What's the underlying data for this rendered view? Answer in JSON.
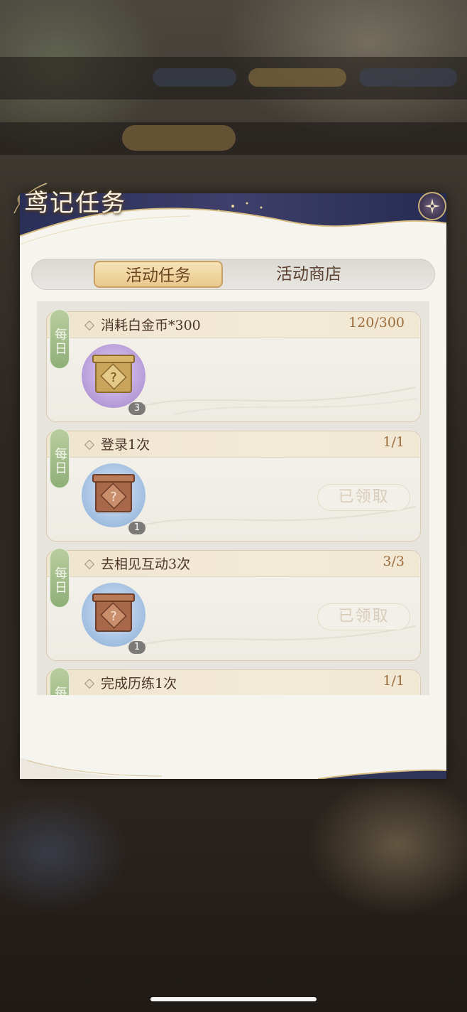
{
  "panel": {
    "title": "鸢记任务",
    "close_label": "",
    "tabs": [
      {
        "label": "活动任务",
        "active": true
      },
      {
        "label": "活动商店",
        "active": false
      }
    ]
  },
  "tasks": [
    {
      "tag": "每日",
      "name": "消耗白金币*300",
      "progress": "120/300",
      "reward_qty": "3",
      "reward_bg": "purple",
      "claimed": false,
      "claimed_label": ""
    },
    {
      "tag": "每日",
      "name": "登录1次",
      "progress": "1/1",
      "reward_qty": "1",
      "reward_bg": "blue",
      "claimed": true,
      "claimed_label": "已领取"
    },
    {
      "tag": "每日",
      "name": "去相见互动3次",
      "progress": "3/3",
      "reward_qty": "1",
      "reward_bg": "blue",
      "claimed": true,
      "claimed_label": "已领取"
    },
    {
      "tag": "每日",
      "name": "完成历练1次",
      "progress": "1/1",
      "reward_qty": "",
      "reward_bg": "blue",
      "claimed": false,
      "claimed_label": ""
    }
  ],
  "colors": {
    "accent_gold": "#caa064",
    "progress_text": "#9b6b3b",
    "daily_tag": "#8eaf78",
    "header_navy": "#2d3560"
  },
  "icons": {
    "close": "compass-star-icon",
    "reward": "mystery-chest-icon"
  }
}
